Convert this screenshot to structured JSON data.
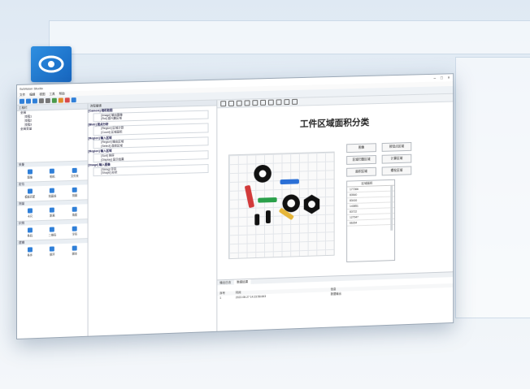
{
  "app": {
    "title": "SciVision Studio",
    "menu": [
      "文件",
      "编辑",
      "视图",
      "工具",
      "帮助"
    ],
    "left_panel": {
      "title": "工程栏",
      "tree": [
        "全局",
        "流程1",
        "流程2",
        "流程3",
        "全局变量"
      ],
      "tool_groups": [
        {
          "name": "采集",
          "items": [
            "图像",
            "相机",
            "文件夹"
          ]
        },
        {
          "name": "定位",
          "items": [
            "模板匹配",
            "找直线",
            "找圆"
          ]
        },
        {
          "name": "测量",
          "items": [
            "卡尺",
            "距离",
            "角度"
          ]
        },
        {
          "name": "识别",
          "items": [
            "条码",
            "二维码",
            "字符"
          ]
        },
        {
          "name": "逻辑",
          "items": [
            "条件",
            "循环",
            "脚本"
          ]
        }
      ]
    },
    "mid_panel": {
      "title": "流程编辑",
      "items": [
        "[Camera] 相机取图",
        "[Image] 输出图像",
        "[Roi] 感兴趣区域",
        "[Blob] 斑点分析",
        "[Region] 区域计算",
        "[Count] 区域面积",
        "[Region] 输入区域",
        "[Region] 输出区域",
        "[Select] 选择区域",
        "[Region] 输入区域",
        "[Sort] 排序",
        "[Display] 显示结果",
        "[Image] 输入图像",
        "[String] 字符",
        "[Shape] 形状"
      ]
    },
    "result_title": "工件区域面积分类",
    "buttons": [
      "图像",
      "按钮点区域",
      "区域归整区域",
      "计算区域",
      "面积区域",
      "螺栓区域"
    ],
    "result_list": {
      "header": "区域面积",
      "values": [
        "177366",
        "83540",
        "83416",
        "143851",
        "83722",
        "127947",
        "66264"
      ]
    },
    "bottom": {
      "tabs": [
        "输出日志",
        "数据结果"
      ],
      "log_headers": [
        "序号",
        "时间",
        "信息"
      ],
      "log_rows": [
        [
          "1",
          "2022-08-27 14:23:58.663",
          "数据输出"
        ]
      ]
    }
  }
}
